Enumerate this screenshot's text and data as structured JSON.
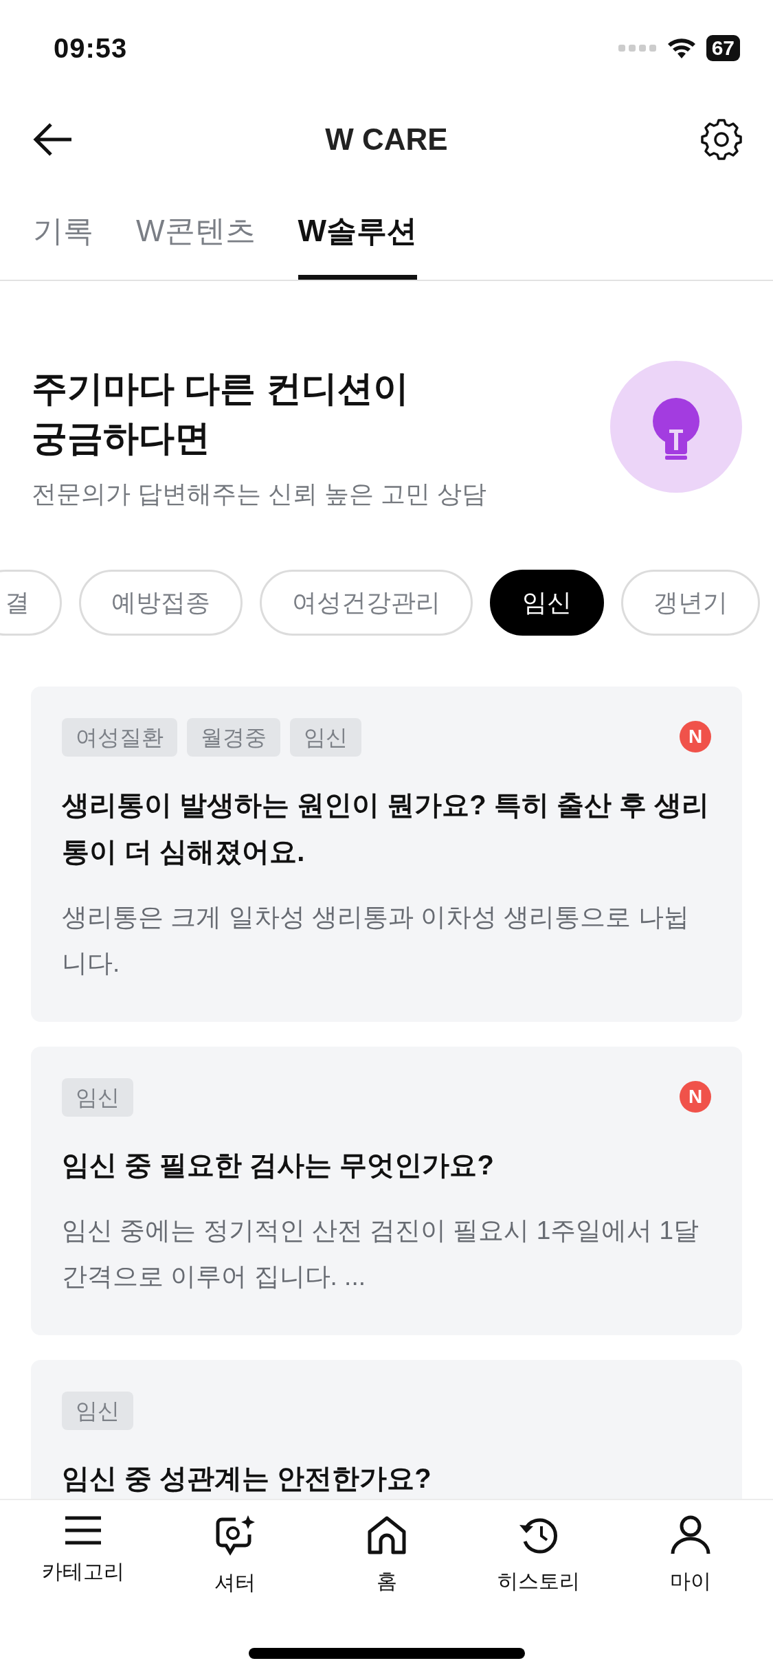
{
  "status_bar": {
    "time": "09:53",
    "battery": "67"
  },
  "header": {
    "title": "W CARE"
  },
  "tabs": [
    {
      "label": "기록",
      "selected": false
    },
    {
      "label": "W콘텐츠",
      "selected": false
    },
    {
      "label": "W솔루션",
      "selected": true
    }
  ],
  "hero": {
    "title": "주기마다 다른 컨디션이\n궁금하다면",
    "subtitle": "전문의가 답변해주는 신뢰 높은 고민 상담"
  },
  "chips": [
    {
      "label": "결",
      "selected": false
    },
    {
      "label": "예방접종",
      "selected": false
    },
    {
      "label": "여성건강관리",
      "selected": false
    },
    {
      "label": "임신",
      "selected": true
    },
    {
      "label": "갱년기",
      "selected": false
    }
  ],
  "cards": [
    {
      "tags": [
        "여성질환",
        "월경중",
        "임신"
      ],
      "new": true,
      "new_badge": "N",
      "title": "생리통이 발생하는 원인이 뭔가요? 특히 출산 후 생리통이 더 심해졌어요.",
      "body": "생리통은 크게 일차성 생리통과 이차성 생리통으로 나뉩니다."
    },
    {
      "tags": [
        "임신"
      ],
      "new": true,
      "new_badge": "N",
      "title": "임신 중 필요한 검사는 무엇인가요?",
      "body": "임신 중에는 정기적인 산전 검진이 필요시 1주일에서 1달 간격으로 이루어 집니다. ..."
    },
    {
      "tags": [
        "임신"
      ],
      "new": false,
      "title": "임신 중 성관계는 안전한가요?"
    }
  ],
  "nav": [
    {
      "kind": "category",
      "label": "카테고리"
    },
    {
      "kind": "shutter",
      "label": "셔터"
    },
    {
      "kind": "home",
      "label": "홈"
    },
    {
      "kind": "history",
      "label": "히스토리"
    },
    {
      "kind": "my",
      "label": "마이"
    }
  ]
}
